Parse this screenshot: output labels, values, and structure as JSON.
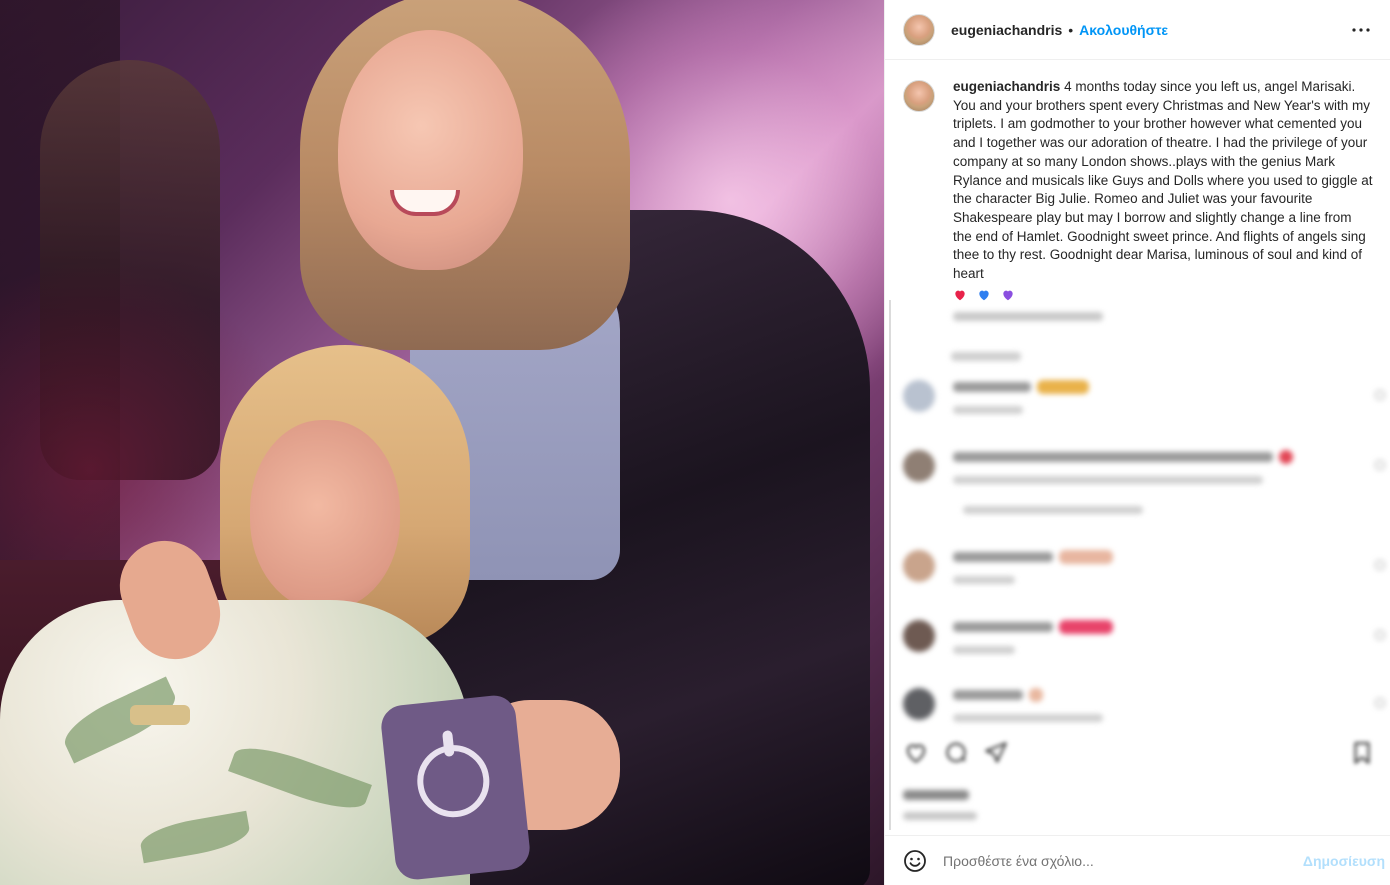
{
  "post": {
    "username": "eugeniachandris",
    "separator": "•",
    "follow_label": "Ακολουθήστε",
    "more_icon": "more-horizontal-icon"
  },
  "caption": {
    "username": "eugeniachandris",
    "text": "4 months today since you left us, angel Marisaki. You and your brothers spent every Christmas and New Year's with my triplets. I am godmother to your brother however what cemented you and I together was our adoration of theatre. I had the privilege of your company at so many London shows..plays with the genius Mark Rylance and musicals like Guys and Dolls where you used to giggle at the character Big Julie. Romeo and Juliet was your favourite Shakespeare play but may I borrow and slightly change a line from the end of Hamlet. Goodnight sweet prince. And flights of angels sing thee to thy rest. Goodnight dear Marisa, luminous of soul and kind of heart",
    "hearts": [
      {
        "icon": "red-heart-icon",
        "color": "#e8234a"
      },
      {
        "icon": "blue-heart-icon",
        "color": "#2f7ff0"
      },
      {
        "icon": "purple-heart-icon",
        "color": "#8b4fe0"
      }
    ]
  },
  "colors": {
    "accent": "#0095f6",
    "post_disabled": "#b2dffc",
    "secondary_text": "#8e8e8e",
    "border": "#efefef"
  },
  "composer": {
    "placeholder": "Προσθέστε ένα σχόλιο...",
    "post_label": "Δημοσίευση",
    "emoji_icon": "smiley-icon"
  }
}
